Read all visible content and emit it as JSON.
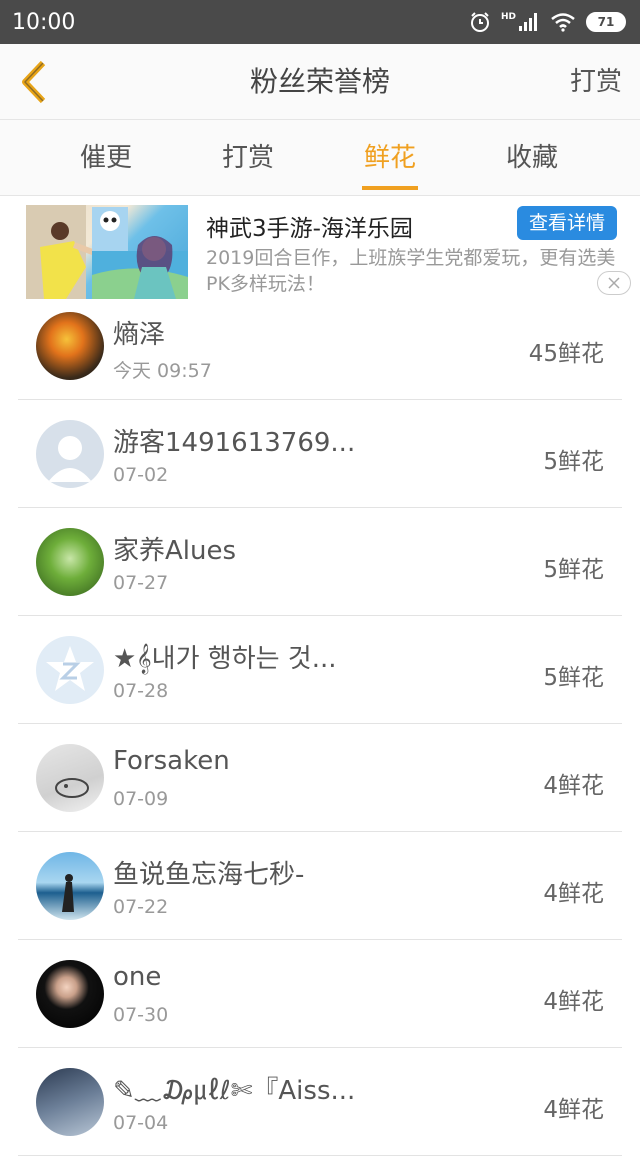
{
  "status_bar": {
    "time": "10:00",
    "battery": "71",
    "network": "HD",
    "icons": [
      "alarm-icon",
      "signal-icon",
      "wifi-icon",
      "battery-icon"
    ]
  },
  "header": {
    "title": "粉丝荣誉榜",
    "action": "打赏",
    "back_icon": "chevron-left-icon",
    "accent_color": "#f0a020"
  },
  "tabs": [
    {
      "label": "催更",
      "active": false
    },
    {
      "label": "打赏",
      "active": false
    },
    {
      "label": "鲜花",
      "active": true
    },
    {
      "label": "收藏",
      "active": false
    }
  ],
  "ad": {
    "title": "神武3手游-海洋乐园",
    "button": "查看详情",
    "description": "2019回合巨作，上班族学生党都爱玩，更有选美PK多样玩法！",
    "button_color": "#2a8be0"
  },
  "fans": [
    {
      "name": "熵泽",
      "date": "今天 09:57",
      "count": "45鲜花"
    },
    {
      "name": "游客1491613769...",
      "date": "07-02",
      "count": "5鲜花"
    },
    {
      "name": "家养Alues",
      "date": "07-27",
      "count": "5鲜花"
    },
    {
      "name": "★𝄞내가 행하는 것...",
      "date": "07-28",
      "count": "5鲜花"
    },
    {
      "name": "Forsaken",
      "date": "07-09",
      "count": "4鲜花"
    },
    {
      "name": "鱼说鱼忘海七秒-",
      "date": "07-22",
      "count": "4鲜花"
    },
    {
      "name": "one",
      "date": "07-30",
      "count": "4鲜花"
    },
    {
      "name": "✎﹏₯㎕ℓ✄『Aiss...",
      "date": "07-04",
      "count": "4鲜花"
    }
  ]
}
